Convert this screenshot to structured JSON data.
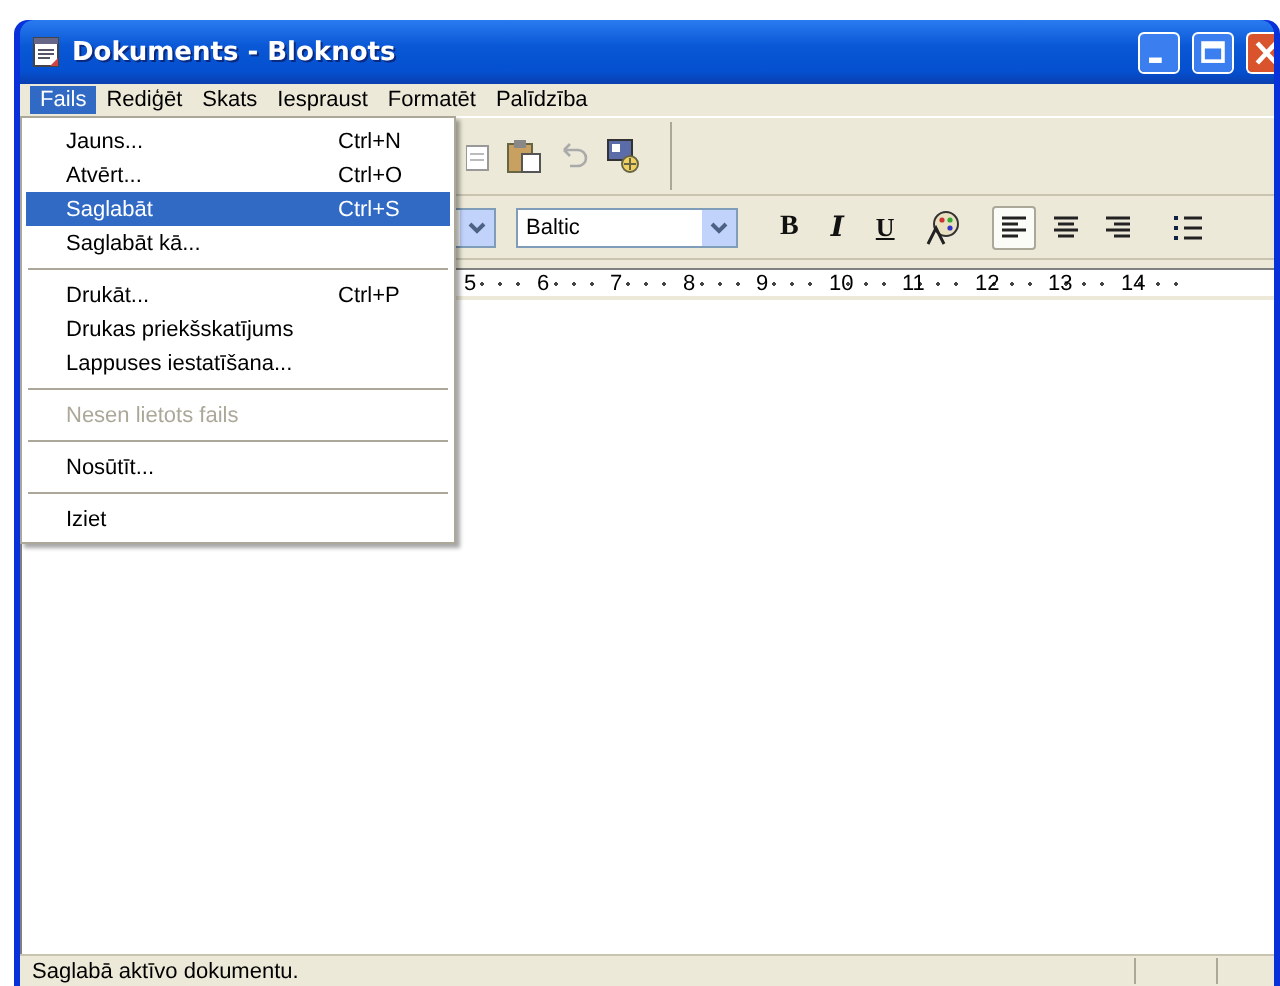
{
  "window": {
    "title": "Dokuments - Bloknots"
  },
  "menu_bar": [
    {
      "label": "Fails",
      "selected": true
    },
    {
      "label": "Rediģēt",
      "selected": false
    },
    {
      "label": "Skats",
      "selected": false
    },
    {
      "label": "Iespraust",
      "selected": false
    },
    {
      "label": "Formatēt",
      "selected": false
    },
    {
      "label": "Palīdzība",
      "selected": false
    }
  ],
  "file_menu": [
    {
      "kind": "item",
      "label": "Jauns...",
      "shortcut": "Ctrl+N",
      "selected": false,
      "disabled": false
    },
    {
      "kind": "item",
      "label": "Atvērt...",
      "shortcut": "Ctrl+O",
      "selected": false,
      "disabled": false
    },
    {
      "kind": "item",
      "label": "Saglabāt",
      "shortcut": "Ctrl+S",
      "selected": true,
      "disabled": false
    },
    {
      "kind": "item",
      "label": "Saglabāt kā...",
      "selected": false,
      "disabled": false
    },
    {
      "kind": "separator"
    },
    {
      "kind": "item",
      "label": "Drukāt...",
      "shortcut": "Ctrl+P",
      "selected": false,
      "disabled": false
    },
    {
      "kind": "item",
      "label": "Drukas priekšskatījums",
      "selected": false,
      "disabled": false
    },
    {
      "kind": "item",
      "label": "Lappuses iestatīšana...",
      "selected": false,
      "disabled": false
    },
    {
      "kind": "separator"
    },
    {
      "kind": "item",
      "label": "Nesen lietots fails",
      "selected": false,
      "disabled": true
    },
    {
      "kind": "separator"
    },
    {
      "kind": "item",
      "label": "Nosūtīt...",
      "selected": false,
      "disabled": false
    },
    {
      "kind": "separator"
    },
    {
      "kind": "item",
      "label": "Iziet",
      "selected": false,
      "disabled": false
    }
  ],
  "format_bar": {
    "script": "Baltic",
    "style_buttons": [
      {
        "kind": "bold",
        "label": "B"
      },
      {
        "kind": "italic",
        "label": "I"
      },
      {
        "kind": "underline",
        "label": "U"
      }
    ],
    "alignment_buttons": [
      {
        "kind": "left",
        "selected": true
      },
      {
        "kind": "center",
        "selected": false
      },
      {
        "kind": "right",
        "selected": false
      }
    ]
  },
  "ruler": [
    "5",
    "6",
    "7",
    "8",
    "9",
    "10",
    "11",
    "12",
    "13",
    "14"
  ],
  "status_bar": {
    "text": "Saglabā aktīvo dokumentu."
  }
}
